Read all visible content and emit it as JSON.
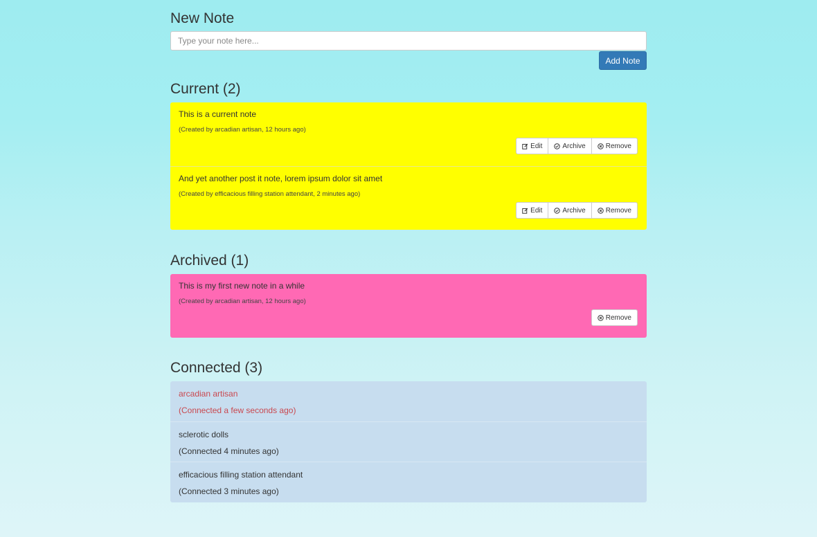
{
  "new_note": {
    "heading": "New Note",
    "placeholder": "Type your note here...",
    "add_label": "Add Note"
  },
  "current": {
    "heading": "Current (2)",
    "notes": [
      {
        "text": "This is a current note",
        "meta": "(Created by arcadian artisan, 12 hours ago)"
      },
      {
        "text": "And yet another post it note, lorem ipsum dolor sit amet",
        "meta": "(Created by efficacious filling station attendant, 2 minutes ago)"
      }
    ]
  },
  "archived": {
    "heading": "Archived (1)",
    "notes": [
      {
        "text": "This is my first new note in a while",
        "meta": "(Created by arcadian artisan, 12 hours ago)"
      }
    ]
  },
  "actions": {
    "edit": "Edit",
    "archive": "Archive",
    "remove": "Remove"
  },
  "connected": {
    "heading": "Connected (3)",
    "users": [
      {
        "name": "arcadian artisan",
        "time": "(Connected a few seconds ago)"
      },
      {
        "name": "sclerotic dolls",
        "time": "(Connected 4 minutes ago)"
      },
      {
        "name": "efficacious filling station attendant",
        "time": "(Connected 3 minutes ago)"
      }
    ]
  },
  "colors": {
    "current_note_bg": "#ffff00",
    "archived_note_bg": "#ff69b4",
    "connected_bg": "#c7ddef",
    "primary_button": "#337ab7",
    "self_user_text": "#c9484f"
  },
  "icons": {
    "edit": "edit-icon",
    "archive": "check-circle-icon",
    "remove": "remove-circle-icon"
  }
}
